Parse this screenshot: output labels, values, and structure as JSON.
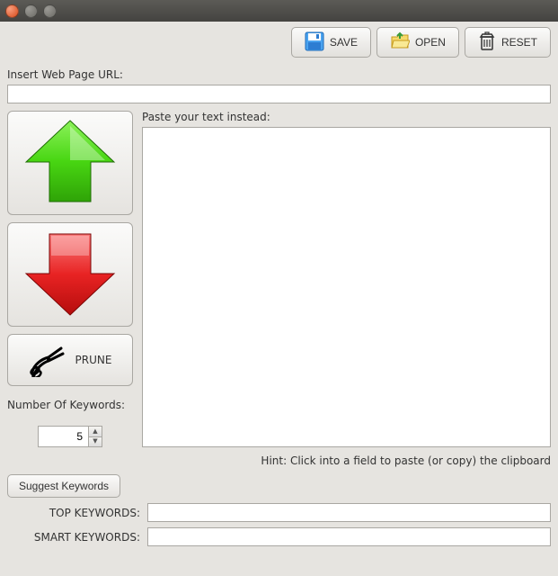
{
  "toolbar": {
    "save_label": "SAVE",
    "open_label": "OPEN",
    "reset_label": "RESET"
  },
  "url_section": {
    "label": "Insert Web Page URL:",
    "value": ""
  },
  "text_section": {
    "label": "Paste your text instead:",
    "value": ""
  },
  "actions": {
    "prune_label": "PRUNE"
  },
  "keywords": {
    "count_label": "Number Of Keywords:",
    "count_value": "5",
    "suggest_label": "Suggest Keywords",
    "top_label": "TOP KEYWORDS:",
    "top_value": "",
    "smart_label": "SMART KEYWORDS:",
    "smart_value": ""
  },
  "hint": "Hint: Click into a field to paste (or copy) the clipboard"
}
